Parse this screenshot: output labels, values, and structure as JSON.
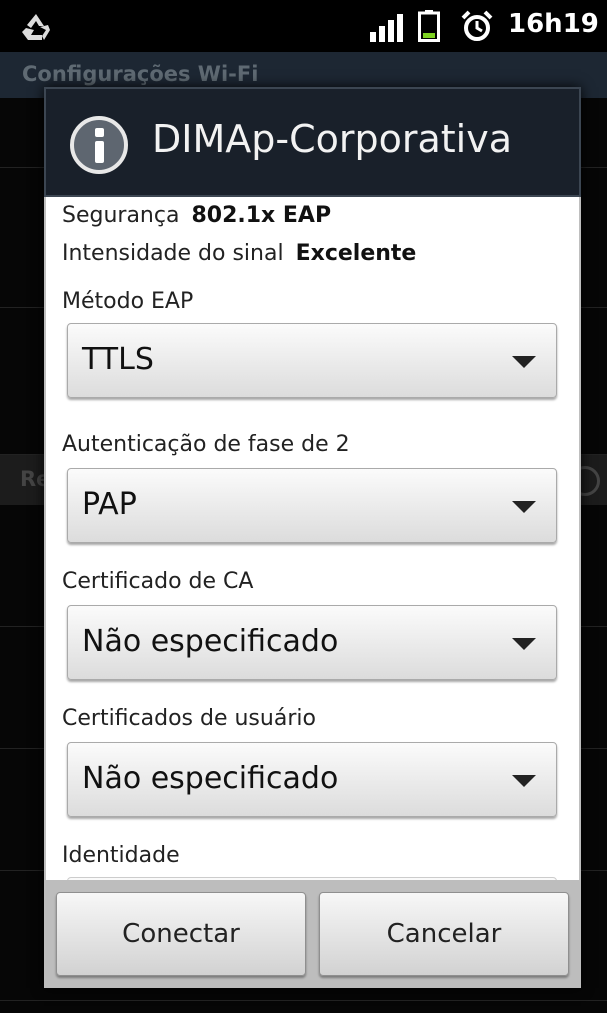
{
  "status_bar": {
    "time": "16h19",
    "icons": [
      "recycle-icon",
      "signal-icon",
      "battery-icon",
      "alarm-icon"
    ],
    "battery_color": "#7ed321"
  },
  "background": {
    "title": "Configurações Wi-Fi",
    "section_label": "Re"
  },
  "dialog": {
    "title": "DIMAp-Corporativa",
    "icon": "info-icon",
    "security_label": "Segurança",
    "security_value": "802.1x EAP",
    "signal_label": "Intensidade do sinal",
    "signal_value": "Excelente",
    "eap_method_label": "Método EAP",
    "eap_method_value": "TTLS",
    "phase2_label": "Autenticação de fase de 2",
    "phase2_value": "PAP",
    "ca_cert_label": "Certificado de CA",
    "ca_cert_value": "Não especificado",
    "user_cert_label": "Certificados de usuário",
    "user_cert_value": "Não especificado",
    "identity_label": "Identidade",
    "connect_label": "Conectar",
    "cancel_label": "Cancelar"
  }
}
